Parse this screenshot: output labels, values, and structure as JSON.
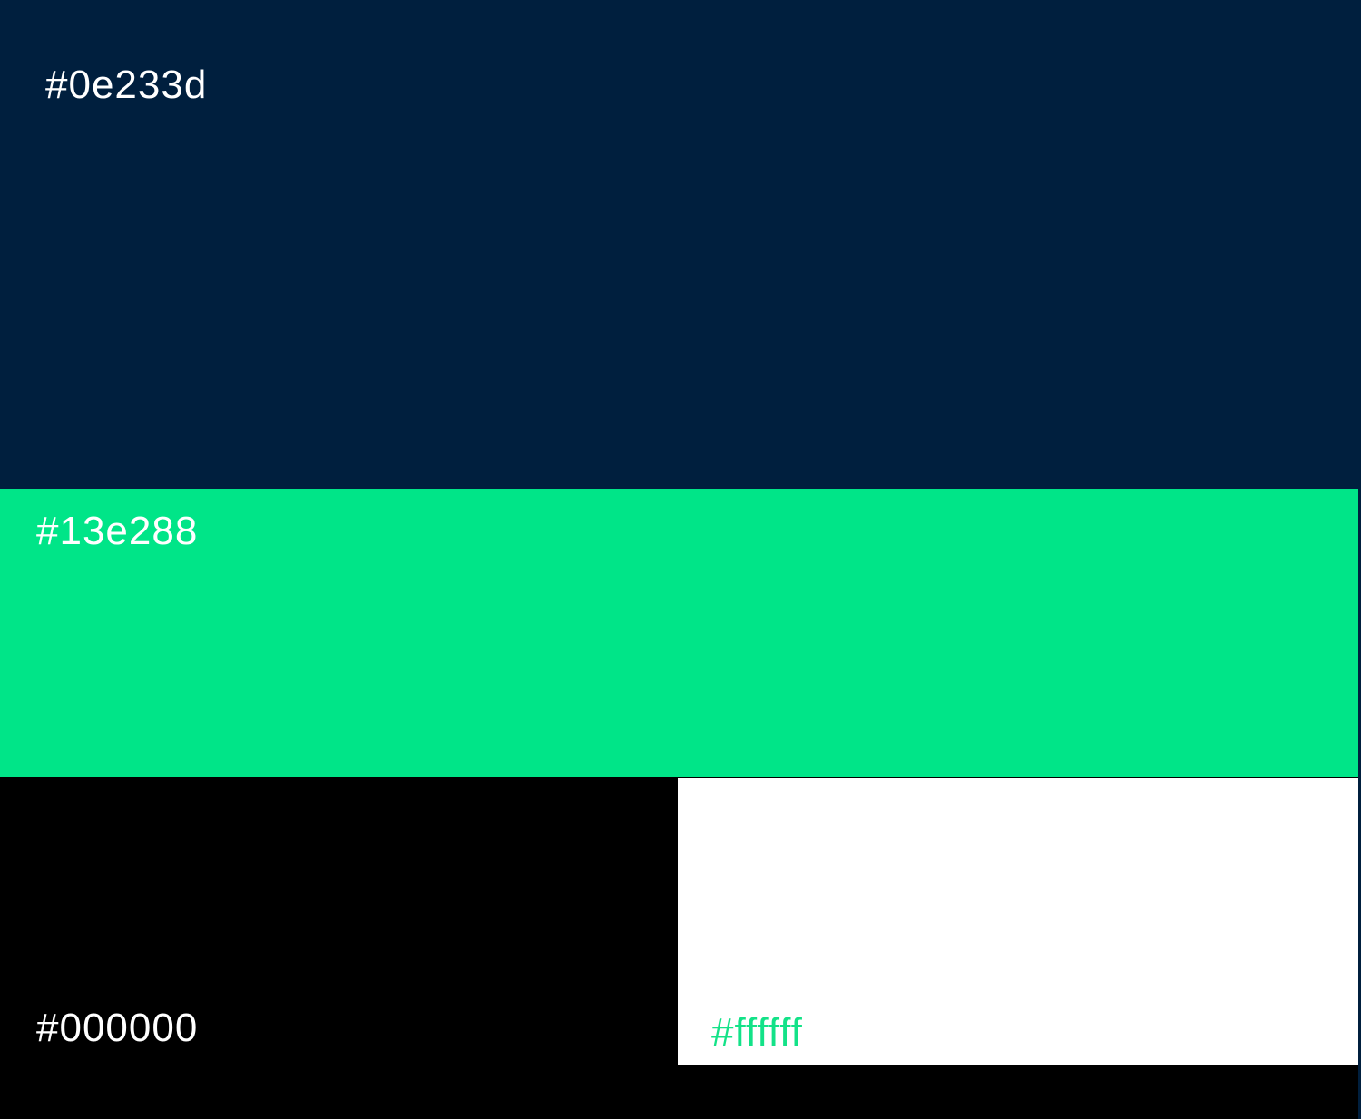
{
  "swatches": [
    {
      "label": "#0e233d",
      "fill": "#001f3e",
      "text_color": "#ffffff"
    },
    {
      "label": "#13e288",
      "fill": "#00e588",
      "text_color": "#ffffff"
    },
    {
      "label": "#000000",
      "fill": "#000000",
      "text_color": "#ffffff"
    },
    {
      "label": "#ffffff",
      "fill": "#ffffff",
      "text_color": "#13e288"
    }
  ]
}
